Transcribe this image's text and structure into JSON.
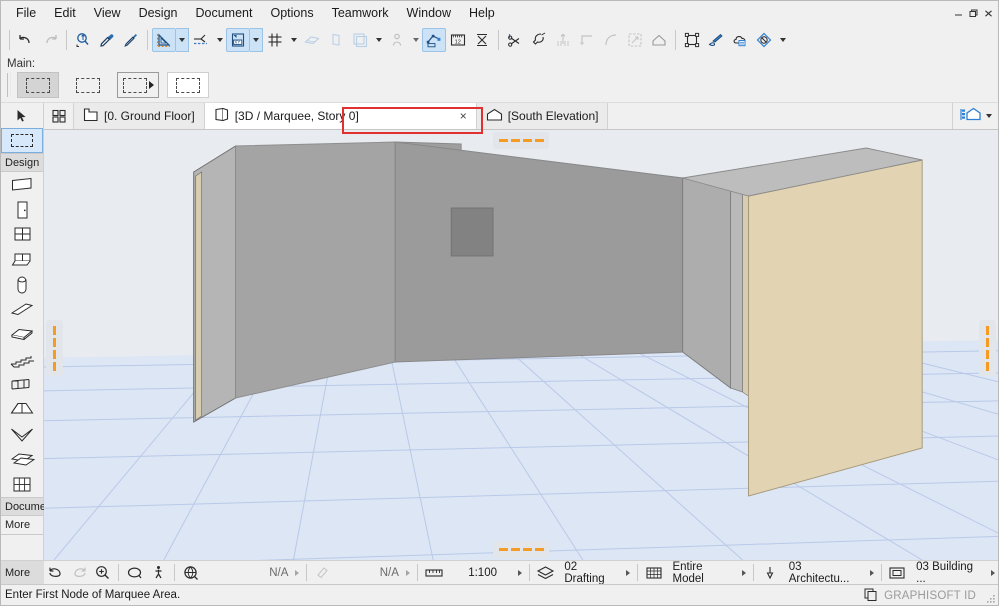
{
  "window": {
    "controls": [
      {
        "name": "minimize-button",
        "glyph": "minimize"
      },
      {
        "name": "restore-button",
        "glyph": "restore"
      },
      {
        "name": "close-button",
        "glyph": "close"
      }
    ]
  },
  "menubar": {
    "items": [
      "File",
      "Edit",
      "View",
      "Design",
      "Document",
      "Options",
      "Teamwork",
      "Window",
      "Help"
    ]
  },
  "toolbar": {
    "groups": [
      {
        "name": "undo",
        "icon": "undo-icon",
        "state": "enabled"
      },
      {
        "name": "redo",
        "icon": "redo-icon",
        "state": "disabled"
      },
      {
        "name": "zoom-find",
        "icon": "zoom-find-icon",
        "state": "enabled"
      },
      {
        "name": "pick-up-parameters",
        "icon": "eyedropper-icon",
        "state": "enabled"
      },
      {
        "name": "inject-parameters",
        "icon": "syringe-icon",
        "state": "enabled"
      },
      {
        "name": "guide-lines",
        "icon": "triangle-ruler-icon",
        "state": "active"
      },
      {
        "name": "snap-points",
        "icon": "snap-point-icon",
        "state": "enabled"
      },
      {
        "name": "coordinate-origin",
        "icon": "xy-origin-icon",
        "state": "active"
      },
      {
        "name": "grid-snap",
        "icon": "grid-snap-icon",
        "state": "enabled"
      },
      {
        "name": "align-view",
        "icon": "plane-icon",
        "state": "disabled"
      },
      {
        "name": "elevate-view",
        "icon": "elevation-icon",
        "state": "disabled"
      },
      {
        "name": "marquee-copy",
        "icon": "layers-square-icon",
        "state": "disabled"
      },
      {
        "name": "figure-person",
        "icon": "person-icon",
        "state": "disabled"
      },
      {
        "name": "3d-document",
        "icon": "3d-axes-icon",
        "state": "active"
      },
      {
        "name": "measure",
        "icon": "ruler-12-icon",
        "state": "enabled"
      },
      {
        "name": "area-measure",
        "icon": "area-measure-icon",
        "state": "enabled"
      },
      {
        "name": "trim",
        "icon": "scissors-icon",
        "state": "enabled"
      },
      {
        "name": "magic-wand",
        "icon": "magic-wand-icon",
        "state": "enabled"
      },
      {
        "name": "split",
        "icon": "split-up-icon",
        "state": "disabled"
      },
      {
        "name": "offset",
        "icon": "offset-corner-icon",
        "state": "disabled"
      },
      {
        "name": "fillet",
        "icon": "fillet-arc-icon",
        "state": "disabled"
      },
      {
        "name": "resize",
        "icon": "resize-icon",
        "state": "disabled"
      },
      {
        "name": "roof-home",
        "icon": "home-icon",
        "state": "disabled"
      },
      {
        "name": "group",
        "icon": "group-nodes-icon",
        "state": "enabled"
      },
      {
        "name": "paint-transfer",
        "icon": "paint-brush-icon",
        "state": "enabled"
      },
      {
        "name": "cloud-note",
        "icon": "cloud-note-icon",
        "state": "enabled"
      },
      {
        "name": "surface-painter",
        "icon": "surface-paint-icon",
        "state": "enabled"
      }
    ]
  },
  "main_palette": {
    "label": "Main:",
    "buttons": [
      {
        "name": "marquee-tool-pressed",
        "icon": "marquee-icon",
        "state": "pressed"
      },
      {
        "name": "marquee-plain",
        "icon": "marquee-icon",
        "state": "normal"
      },
      {
        "name": "marquee-flyout",
        "icon": "marquee-icon",
        "state": "framed"
      },
      {
        "name": "marquee-white",
        "icon": "marquee-icon",
        "state": "white"
      }
    ]
  },
  "toolbox": {
    "groups": [
      {
        "header": null,
        "tools": [
          {
            "name": "arrow-tool",
            "icon": "arrow-icon",
            "selected": false
          },
          {
            "name": "marquee-tool",
            "icon": "marquee-icon",
            "selected": true
          }
        ]
      },
      {
        "header": "Design",
        "tools": [
          {
            "name": "wall-tool",
            "icon": "wall-icon",
            "selected": false
          },
          {
            "name": "door-tool",
            "icon": "door-icon",
            "selected": false
          },
          {
            "name": "window-tool",
            "icon": "window-icon",
            "selected": false
          },
          {
            "name": "skylight-tool",
            "icon": "skylight-icon",
            "selected": false
          },
          {
            "name": "column-tool",
            "icon": "column-icon",
            "selected": false
          },
          {
            "name": "beam-tool",
            "icon": "beam-icon",
            "selected": false
          },
          {
            "name": "slab-tool",
            "icon": "slab-icon",
            "selected": false
          },
          {
            "name": "stair-tool",
            "icon": "stair-icon",
            "selected": false
          },
          {
            "name": "railing-tool",
            "icon": "railing-icon",
            "selected": false
          },
          {
            "name": "roof-tool",
            "icon": "roof-icon",
            "selected": false
          },
          {
            "name": "shell-tool",
            "icon": "shell-icon",
            "selected": false
          },
          {
            "name": "morph-tool",
            "icon": "morph-icon",
            "selected": false
          },
          {
            "name": "curtain-wall-tool",
            "icon": "curtain-wall-icon",
            "selected": false
          }
        ]
      },
      {
        "header": "Docume",
        "tools": []
      }
    ],
    "more_label": "More"
  },
  "tabs": {
    "grid_icon": "tab-grid-icon",
    "items": [
      {
        "label": "[0. Ground Floor]",
        "icon": "floor-plan-icon",
        "active": false,
        "closable": false
      },
      {
        "label": "[3D / Marquee, Story 0]",
        "icon": "3d-box-icon",
        "active": true,
        "closable": true,
        "close_label": "×",
        "highlighted": true
      },
      {
        "label": "[South Elevation]",
        "icon": "elevation-house-icon",
        "active": false,
        "closable": false
      }
    ],
    "right_button": {
      "name": "project-tree-button",
      "icon": "blue-house-icon"
    }
  },
  "canvas": {
    "description": "3D view of three walls forming a U shape on a blue grid floor",
    "background": "#e8ecf0",
    "grid_color": "#b8c9e8",
    "floor_color": "#dde6f5",
    "wall_left_color": "#a6a6a6",
    "wall_back_color": "#9e9e9e",
    "wall_right_color": "#e2d4b2",
    "wall_edge_color": "#b9b9b9",
    "window_color": "#828282",
    "marquee_handles": [
      {
        "name": "marquee-handle-top",
        "orientation": "horizontal"
      },
      {
        "name": "marquee-handle-bottom",
        "orientation": "horizontal"
      },
      {
        "name": "marquee-handle-left",
        "orientation": "vertical"
      },
      {
        "name": "marquee-handle-right",
        "orientation": "vertical"
      }
    ]
  },
  "statusbar": {
    "more_label": "More",
    "buttons": [
      {
        "name": "orbit-back-button",
        "icon": "orbit-ccw-icon",
        "state": "enabled"
      },
      {
        "name": "orbit-forward-button",
        "icon": "orbit-cw-icon",
        "state": "disabled"
      },
      {
        "name": "zoom-in-button",
        "icon": "zoom-in-icon",
        "state": "enabled"
      },
      {
        "name": "orbit-button",
        "icon": "orbit-icon",
        "state": "enabled"
      },
      {
        "name": "explore-button",
        "icon": "walk-person-icon",
        "state": "enabled"
      },
      {
        "name": "3d-view-button",
        "icon": "3d-globe-icon",
        "state": "enabled"
      }
    ],
    "fields": [
      {
        "name": "field-na-1",
        "icon": null,
        "value": "N/A",
        "dim": true,
        "has_caret": true
      },
      {
        "name": "field-na-2",
        "icon": "pen-set-icon",
        "value": "N/A",
        "dim": true,
        "has_caret": true
      },
      {
        "name": "scale-field",
        "icon": "scale-ruler-icon",
        "value": "1:100",
        "dim": false,
        "has_caret": true
      },
      {
        "name": "layer-combination-field",
        "icon": "layers-icon",
        "value": "02 Drafting",
        "dim": false,
        "has_caret": true
      },
      {
        "name": "partial-structure-field",
        "icon": "structure-icon",
        "value": "Entire Model",
        "dim": false,
        "has_caret": true
      },
      {
        "name": "pen-set-field",
        "icon": "pen-icon",
        "value": "03 Architectu...",
        "dim": false,
        "has_caret": true
      },
      {
        "name": "model-view-field",
        "icon": "model-view-icon",
        "value": "03 Building ...",
        "dim": false,
        "has_caret": true
      }
    ]
  },
  "prompt": {
    "message": "Enter First Node of Marquee Area.",
    "graphisoft_id": "GRAPHISOFT ID",
    "copy_icon": "copy-icon"
  }
}
